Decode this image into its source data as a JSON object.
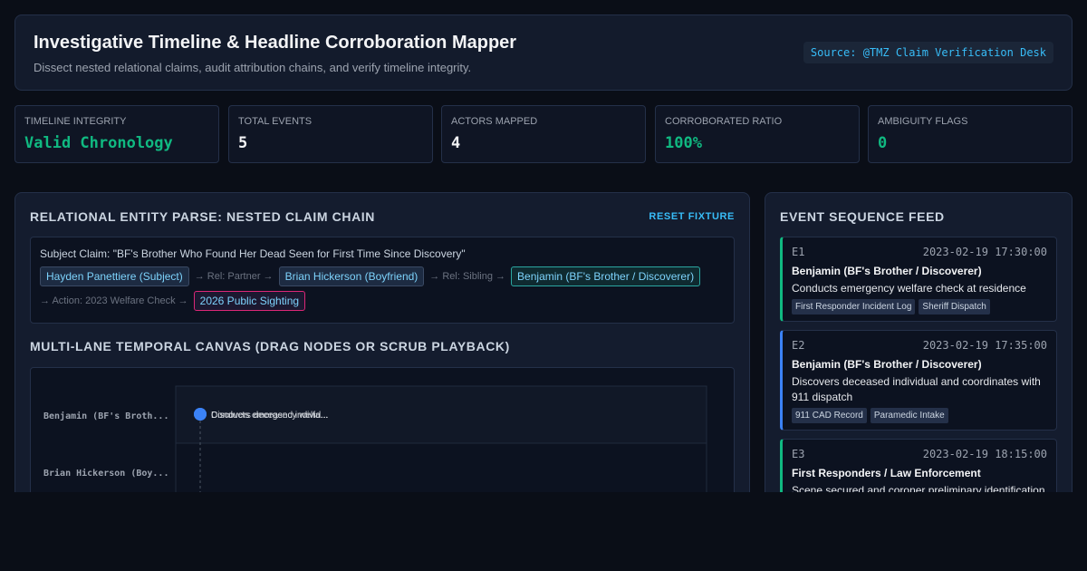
{
  "header": {
    "title": "Investigative Timeline & Headline Corroboration Mapper",
    "subtitle": "Dissect nested relational claims, audit attribution chains, and verify timeline integrity.",
    "source": "Source: @TMZ Claim Verification Desk"
  },
  "stats": [
    {
      "label": "Timeline Integrity",
      "value": "Valid Chronology",
      "color": "#10b981"
    },
    {
      "label": "Total Events",
      "value": "5",
      "color": "#f3f4f6"
    },
    {
      "label": "Actors Mapped",
      "value": "4",
      "color": "#f3f4f6"
    },
    {
      "label": "Corroborated Ratio",
      "value": "100%",
      "color": "#10b981"
    },
    {
      "label": "Ambiguity Flags",
      "value": "0",
      "color": "#10b981"
    }
  ],
  "parse_panel": {
    "title": "Relational Entity Parse: Nested Claim Chain",
    "reset_label": "RESET FIXTURE",
    "claim": "Subject Claim: \"BF's Brother Who Found Her Dead Seen for First Time Since Discovery\"",
    "chain": {
      "subject": "Hayden Panettiere (Subject)",
      "rel_partner": "→ Rel: Partner →",
      "partner": "Brian Hickerson (Boyfriend)",
      "rel_sibling": "→ Rel: Sibling →",
      "sibling": "Benjamin (BF's Brother / Discoverer)",
      "action": "→ Action: 2023 Welfare Check →",
      "event": "2026 Public Sighting"
    }
  },
  "canvas": {
    "title": "Multi-Lane Temporal Canvas (Drag Nodes or Scrub Playback)",
    "lanes": [
      "Benjamin (BF's Broth...",
      "Brian Hickerson (Boy..."
    ],
    "node_labels": [
      "Conducts emergency welfa...",
      "Discovers deceased individ..."
    ],
    "node_color": "#3b82f6"
  },
  "feed": {
    "title": "Event Sequence Feed",
    "events": [
      {
        "id": "E1",
        "time": "2023-02-19 17:30:00",
        "actor": "Benjamin (BF's Brother / Discoverer)",
        "desc": "Conducts emergency welfare check at residence",
        "tags": [
          "First Responder Incident Log",
          "Sheriff Dispatch"
        ],
        "accent": "#10b981"
      },
      {
        "id": "E2",
        "time": "2023-02-19 17:35:00",
        "actor": "Benjamin (BF's Brother / Discoverer)",
        "desc": "Discovers deceased individual and coordinates with 911 dispatch",
        "tags": [
          "911 CAD Record",
          "Paramedic Intake"
        ],
        "accent": "#3b82f6"
      },
      {
        "id": "E3",
        "time": "2023-02-19 18:15:00",
        "actor": "First Responders / Law Enforcement",
        "desc": "Scene secured and coroner preliminary identification",
        "tags": [],
        "accent": "#10b981"
      }
    ]
  }
}
